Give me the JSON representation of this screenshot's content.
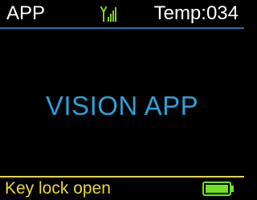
{
  "colors": {
    "background": "#000000",
    "header_text": "#ffffff",
    "header_rule": "#2b6aa8",
    "title": "#2f9fd8",
    "footer_rule": "#e8d63a",
    "footer_text": "#e8d63a",
    "signal": "#7fd321",
    "battery": "#6fe126"
  },
  "status_bar": {
    "app_label": "APP",
    "signal_icon": "signal-icon",
    "temperature": "Temp:034"
  },
  "main": {
    "title": "VISION APP"
  },
  "footer": {
    "status_text": "Key lock open",
    "battery_icon": "battery-icon",
    "battery_level": 1
  }
}
